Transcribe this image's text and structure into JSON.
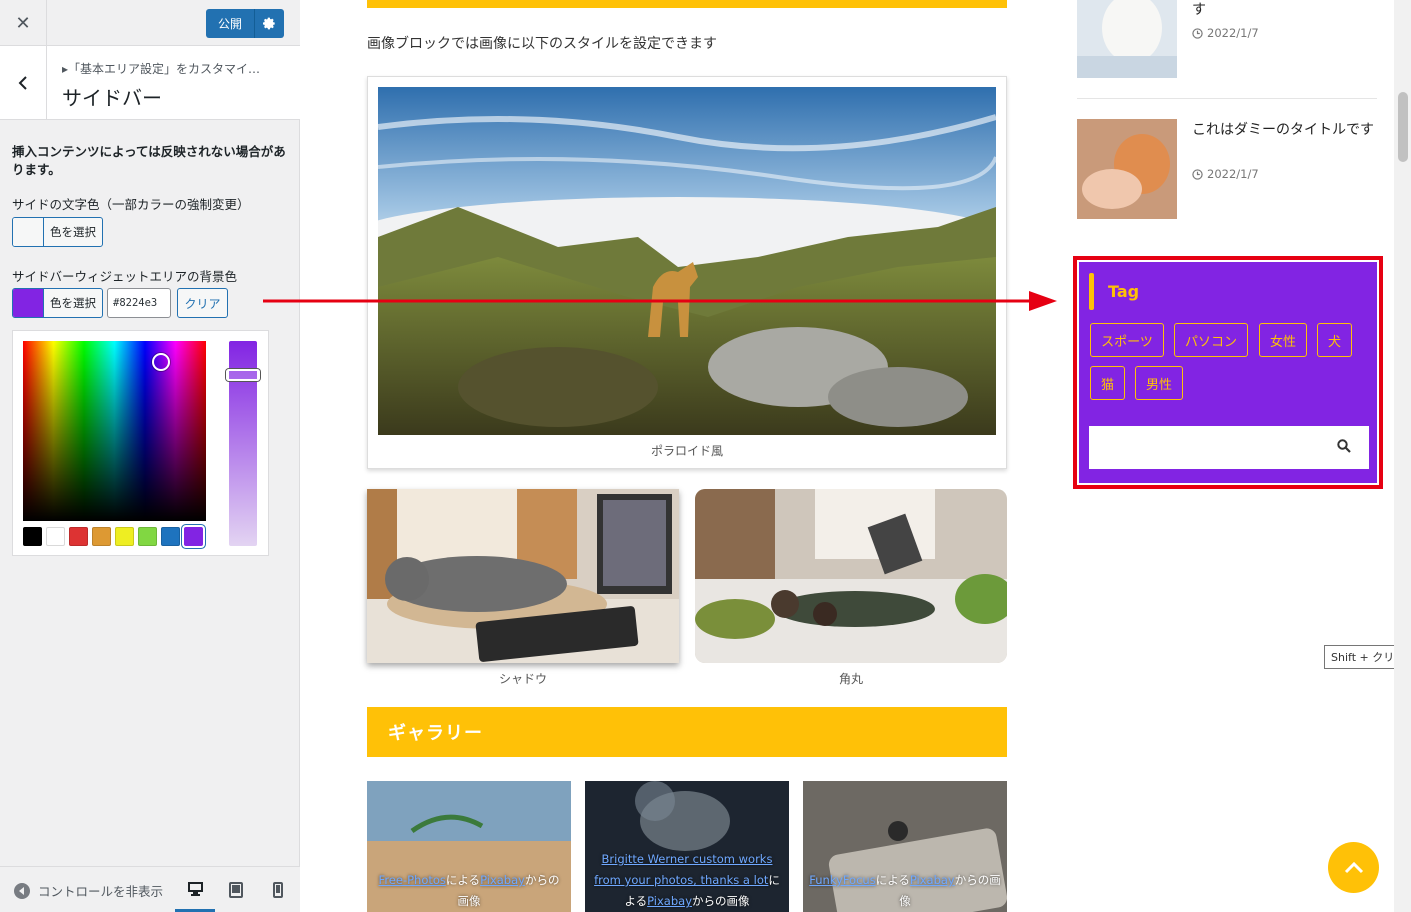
{
  "customizer": {
    "publish_label": "公開",
    "breadcrumb": "▸「基本エリア設定」をカスタマイ…",
    "section_title": "サイドバー",
    "notice": "挿入コンテンツによっては反映されない場合があります。",
    "text_color_label": "サイドの文字色（一部カラーの強制変更）",
    "select_color_label": "色を選択",
    "bg_color_label": "サイドバーウィジェットエリアの背景色",
    "bg_color_value": "#8224e3",
    "clear_label": "クリア",
    "palette": [
      "#000000",
      "#ffffff",
      "#dd3333",
      "#dd9933",
      "#eeee22",
      "#81d742",
      "#1e73be",
      "#8224e3"
    ],
    "hide_controls_label": "コントロールを非表示"
  },
  "preview": {
    "intro_text": "画像ブロックでは画像に以下のスタイルを設定できます",
    "polaroid_caption": "ポラロイド風",
    "shadow_caption": "シャドウ",
    "rounded_caption": "角丸",
    "gallery_heading": "ギャラリー",
    "gallery": [
      {
        "link1": "Free-Photos",
        "mid": "による",
        "link2": "Pixabay",
        "tail": "からの画像"
      },
      {
        "link1": "Brigitte Werner custom works from your photos, thanks a lot",
        "mid": "による",
        "link2": "Pixabay",
        "tail": "からの画像"
      },
      {
        "link1": "FunkyFocus",
        "mid": "による",
        "link2": "Pixabay",
        "tail": "からの画像"
      }
    ],
    "posts": [
      {
        "title": "す",
        "date": "2022/1/7"
      },
      {
        "title": "これはダミーのタイトルです",
        "date": "2022/1/7"
      }
    ],
    "tag_widget": {
      "title": "Tag",
      "tags": [
        "スポーツ",
        "パソコン",
        "女性",
        "犬",
        "猫",
        "男性"
      ],
      "bg_color": "#8224e3",
      "accent_color": "#ffc107"
    },
    "tooltip": "Shift + クリックで"
  }
}
